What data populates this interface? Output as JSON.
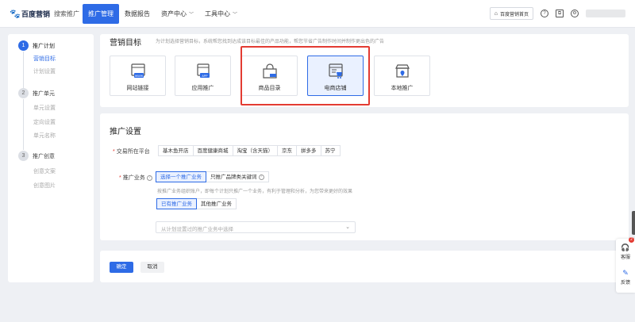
{
  "header": {
    "brand": "百度营销",
    "product": "搜索推广",
    "nav": [
      {
        "label": "推广管理",
        "active": true,
        "dropdown": false
      },
      {
        "label": "数据报告",
        "active": false,
        "dropdown": false
      },
      {
        "label": "资产中心",
        "active": false,
        "dropdown": true
      },
      {
        "label": "工具中心",
        "active": false,
        "dropdown": true
      }
    ],
    "home_button": "百度营销首页",
    "icons": [
      "help-icon",
      "copy-icon",
      "settings-icon"
    ]
  },
  "sidebar": {
    "steps": [
      {
        "num": "1",
        "label": "推广计划",
        "active": true,
        "items": [
          {
            "label": "营销目标",
            "active": true
          },
          {
            "label": "计划设置",
            "active": false
          }
        ]
      },
      {
        "num": "2",
        "label": "推广单元",
        "active": false,
        "items": [
          {
            "label": "单元设置",
            "active": false
          },
          {
            "label": "定向设置",
            "active": false
          },
          {
            "label": "单元名称",
            "active": false
          }
        ]
      },
      {
        "num": "3",
        "label": "推广创意",
        "active": false,
        "items": [
          {
            "label": "创意文案",
            "active": false
          },
          {
            "label": "创意图片",
            "active": false
          }
        ]
      }
    ]
  },
  "marketing": {
    "title": "营销目标",
    "description": "为计划选择营销目标，系统帮您找到达成该目标最佳的产品功能，帮您节省广告制作时间并制作更出色的广告",
    "cards": [
      {
        "label": "网站链接",
        "icon": "web-link-icon",
        "badge": "WWW",
        "selected": false
      },
      {
        "label": "应用推广",
        "icon": "app-promo-icon",
        "badge": "APP",
        "selected": false
      },
      {
        "label": "商品目录",
        "icon": "product-catalog-icon",
        "badge": "",
        "selected": false
      },
      {
        "label": "电商店铺",
        "icon": "ecommerce-store-icon",
        "badge": "",
        "selected": true
      },
      {
        "label": "本地推广",
        "icon": "local-store-icon",
        "badge": "",
        "selected": false
      }
    ]
  },
  "settings": {
    "title": "推广设置",
    "platform": {
      "label": "交易所在平台",
      "options": [
        "基木鱼开店",
        "百度健康商城",
        "淘宝（含天猫）",
        "京东",
        "拼多多",
        "苏宁"
      ]
    },
    "business": {
      "label": "推广业务",
      "options": [
        "选择一个推广业务",
        "只推广品牌类关键词"
      ],
      "hint": "按推广业务组织账户，即每个计划只推广一个业务，有利于管理和分析，为您带来更好的效果",
      "sub_options": [
        "已有推广业务",
        "其他推广业务"
      ],
      "select_placeholder": "从计划设置过的推广业务中选择"
    }
  },
  "actions": {
    "confirm": "确定",
    "cancel": "取消"
  },
  "float_panel": {
    "support_label": "客服",
    "feedback_label": "反馈",
    "badge": "2"
  },
  "colors": {
    "primary": "#2e6be6",
    "highlight": "#e33b32"
  }
}
